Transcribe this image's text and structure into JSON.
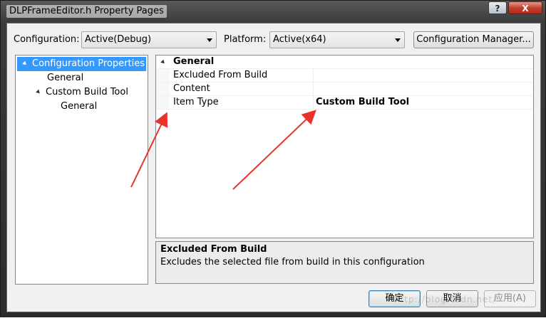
{
  "window": {
    "title": "DLPFrameEditor.h Property Pages",
    "help_label": "?",
    "close_label": "X"
  },
  "toolbar": {
    "configuration_label": "Configuration:",
    "configuration_value": "Active(Debug)",
    "platform_label": "Platform:",
    "platform_value": "Active(x64)",
    "config_manager_label": "Configuration Manager..."
  },
  "tree": {
    "items": [
      {
        "label": "Configuration Properties",
        "expanded": true,
        "selected": true
      },
      {
        "label": "General"
      },
      {
        "label": "Custom Build Tool",
        "expanded": true
      },
      {
        "label": "General"
      }
    ]
  },
  "grid": {
    "section": "General",
    "rows": [
      {
        "name": "Excluded From Build",
        "value": ""
      },
      {
        "name": "Content",
        "value": ""
      },
      {
        "name": "Item Type",
        "value": "Custom Build Tool"
      }
    ]
  },
  "description": {
    "title": "Excluded From Build",
    "text": "Excludes the selected file from build in this configuration"
  },
  "buttons": {
    "ok": "确定",
    "cancel": "取消",
    "apply": "应用(A)"
  },
  "watermark": "http://blog.csdn.net/",
  "colors": {
    "selection": "#3399ff",
    "annotation_arrow": "#e8322b"
  }
}
